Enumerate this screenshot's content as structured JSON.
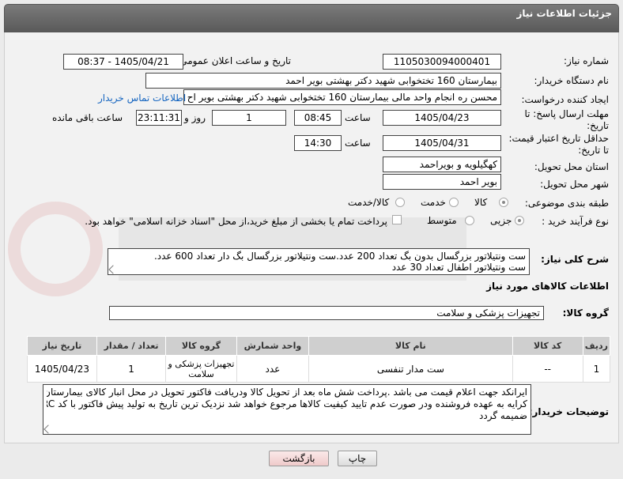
{
  "header": {
    "title": "جزئیات اطلاعات نیاز"
  },
  "fields": {
    "need_number": {
      "label": "شماره نیاز:",
      "value": "1105030094000401"
    },
    "announce_datetime": {
      "label": "تاریخ و ساعت اعلان عمومی:",
      "value": "1405/04/21 - 08:37"
    },
    "buyer_org": {
      "label": "نام دستگاه خریدار:",
      "value": "بیمارستان 160 تختخوابی شهید دکتر بهشتی بویر احمد"
    },
    "requester": {
      "label": "ایجاد کننده درخواست:",
      "value": "محسن ره انجام واحد مالی بیمارستان 160 تختخوابی شهید دکتر بهشتی بویر اح",
      "contact_link": "اطلاعات تماس خریدار"
    },
    "reply_deadline": {
      "label": "مهلت ارسال پاسخ: تا تاریخ:",
      "date": "1405/04/23",
      "time_label": "ساعت",
      "time": "08:45",
      "days": "1",
      "days_label": "روز و",
      "remaining": "23:11:31",
      "remaining_label": "ساعت باقی مانده"
    },
    "price_validity": {
      "label": "حداقل تاریخ اعتبار قیمت: تا تاریخ:",
      "date": "1405/04/31",
      "time_label": "ساعت",
      "time": "14:30"
    },
    "province": {
      "label": "استان محل تحویل:",
      "value": "کهگیلویه و بویراحمد"
    },
    "city": {
      "label": "شهر محل تحویل:",
      "value": "بویر احمد"
    },
    "category": {
      "label": "طبقه بندی موضوعی:",
      "options": [
        "کالا",
        "خدمت",
        "کالا/خدمت"
      ]
    },
    "process_type": {
      "label": "نوع فرآیند خرید :",
      "options": [
        "جزیی",
        "متوسط"
      ],
      "payment_note": "پرداخت تمام یا بخشی از مبلغ خرید،از محل \"اسناد خزانه اسلامی\" خواهد بود."
    }
  },
  "description": {
    "label": "شرح کلی نیاز:",
    "line1": "ست ونتیلاتور بزرگسال بدون بگ تعداد 200 عدد.ست ونتیلاتور بزرگسال بگ دار تعداد 600 عدد.",
    "line2": "ست ونتیلاتور اطفال تعداد 30 عدد"
  },
  "goods_section": {
    "title": "اطلاعات کالاهای مورد نیاز",
    "group_label": "گروه کالا:",
    "group_value": "تجهیزات پزشکی و سلامت"
  },
  "table": {
    "headers": [
      "ردیف",
      "کد کالا",
      "نام کالا",
      "واحد شمارش",
      "گروه کالا",
      "تعداد / مقدار",
      "تاریخ نیاز"
    ],
    "rows": [
      [
        "1",
        "--",
        "ست مدار تنفسی",
        "عدد",
        "تجهیزات پزشکی و سلامت",
        "1",
        "1405/04/23"
      ]
    ]
  },
  "buyer_notes": {
    "label": "توضیحات خریدار:",
    "line1": "ایرانکد جهت اعلام قیمت می باشد .پرداخت شش ماه بعد از تحویل کالا ودریافت فاکتور تحویل در محل انبار کالای بیمارستان",
    "line2": "کرایه به عهده فروشنده ودر صورت عدم تایید کیفیت کالاها مرجوع خواهد شد نزدیک ترین تاریخ به تولید پیش فاکتور با کد IRC",
    "line3": "ضمیمه گردد"
  },
  "buttons": {
    "print": "چاپ",
    "back": "بازگشت"
  }
}
